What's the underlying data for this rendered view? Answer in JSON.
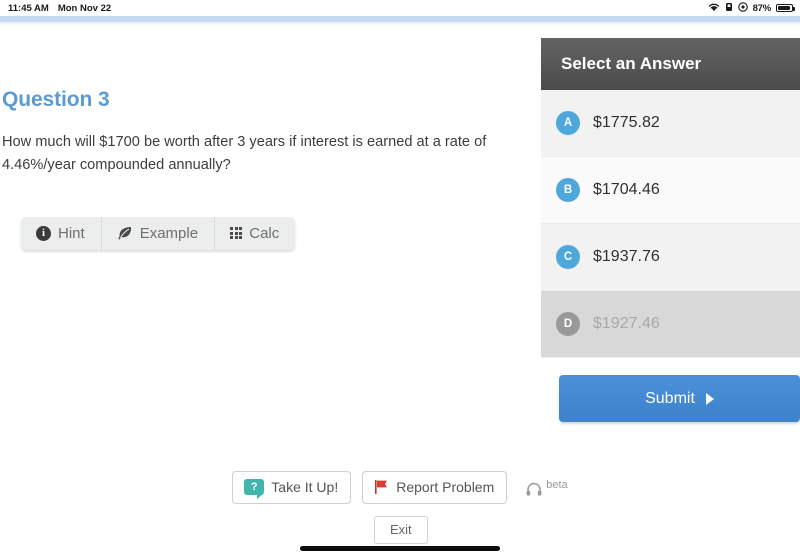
{
  "statusbar": {
    "time": "11:45 AM",
    "date": "Mon Nov 22",
    "battery_percent": "87%",
    "icons": [
      "wifi-icon",
      "alarm-icon",
      "rotation-lock-icon",
      "battery-icon"
    ]
  },
  "question": {
    "title": "Question 3",
    "body": "How much will $1700 be worth after 3 years if interest is earned at a rate of 4.46%/year compounded annually?"
  },
  "toolbar": {
    "hint_label": "Hint",
    "example_label": "Example",
    "calc_label": "Calc"
  },
  "answer_panel": {
    "header": "Select an Answer",
    "options": [
      {
        "letter": "A",
        "value": "$1775.82",
        "disabled": false
      },
      {
        "letter": "B",
        "value": "$1704.46",
        "disabled": false
      },
      {
        "letter": "C",
        "value": "$1937.76",
        "disabled": false
      },
      {
        "letter": "D",
        "value": "$1927.46",
        "disabled": true
      }
    ],
    "submit_label": "Submit"
  },
  "bottombar": {
    "take_it_up_label": "Take It Up!",
    "report_problem_label": "Report Problem",
    "beta_label": "beta",
    "exit_label": "Exit"
  },
  "colors": {
    "accent_blue": "#5b9bd0",
    "badge_blue": "#4fa8dc",
    "submit_blue": "#4a90d9",
    "panel_header_gray": "#4b4b4b",
    "teal": "#3fb5ac",
    "flag_red": "#d93b30",
    "disabled_gray": "#999999"
  }
}
